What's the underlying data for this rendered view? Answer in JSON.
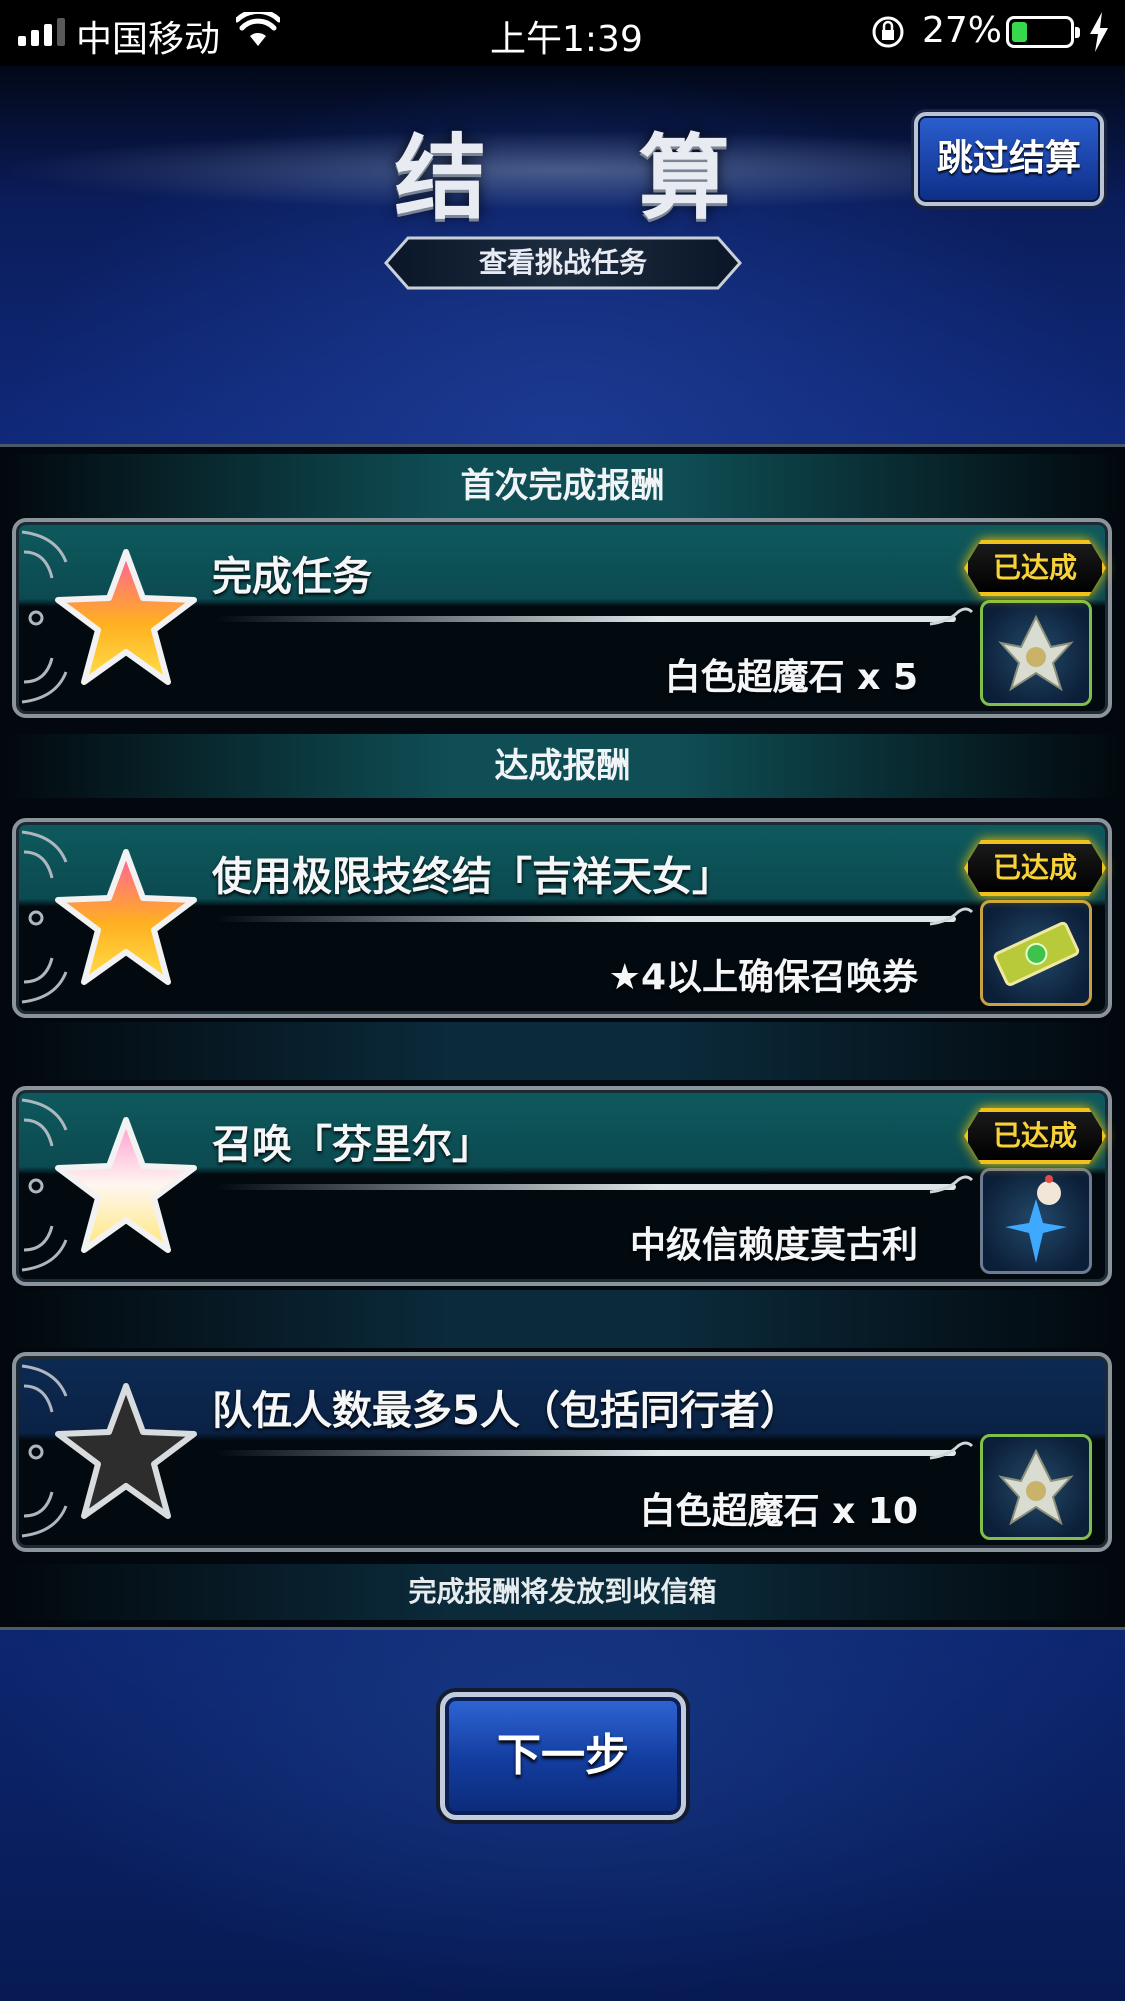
{
  "status_bar": {
    "carrier": "中国移动",
    "time": "上午1:39",
    "battery_percent": "27%",
    "battery_level": 0.27,
    "signal_bars": 3
  },
  "header": {
    "title": "结 算",
    "skip_label": "跳过结算",
    "view_challenge_label": "查看挑战任务"
  },
  "sections": {
    "first_clear_title": "首次完成报酬",
    "achieve_title": "达成报酬"
  },
  "missions": [
    {
      "name": "完成任务",
      "reward": "白色超魔石 x 5",
      "achieved": true,
      "achieved_label": "已达成",
      "star": "gold",
      "item_icon": "crystal-icon"
    },
    {
      "name": "使用极限技终结「吉祥天女」",
      "reward": "★4以上确保召唤券",
      "achieved": true,
      "achieved_label": "已达成",
      "star": "gold",
      "item_icon": "ticket-icon"
    },
    {
      "name": "召唤「芬里尔」",
      "reward": "中级信赖度莫古利",
      "achieved": true,
      "achieved_label": "已达成",
      "star": "white",
      "item_icon": "moogle-icon"
    },
    {
      "name": "队伍人数最多5人（包括同行者）",
      "reward": "白色超魔石 x 10",
      "achieved": false,
      "achieved_label": "",
      "star": "dark",
      "item_icon": "crystal-icon"
    }
  ],
  "footnote": "完成报酬将发放到收信箱",
  "next_label": "下一步",
  "colors": {
    "badge_gold": "#f2c21c",
    "teal_band": "#0e5a5e",
    "button_blue": "#2f66d6"
  }
}
